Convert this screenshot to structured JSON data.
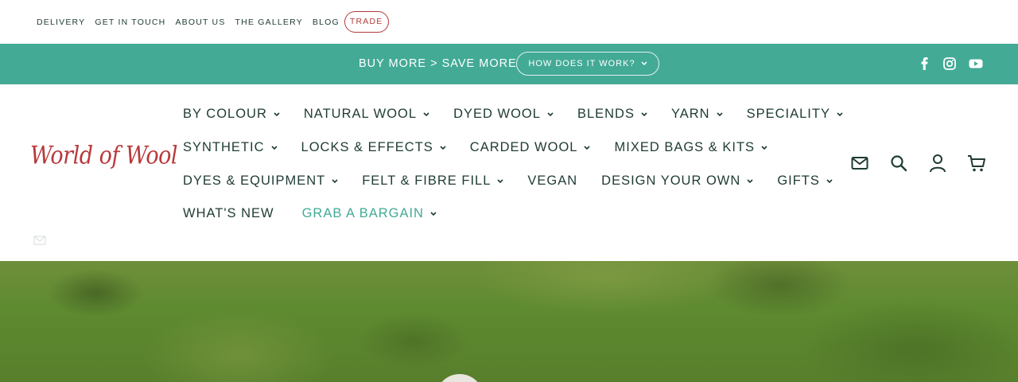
{
  "utility": {
    "links": [
      "DELIVERY",
      "GET IN TOUCH",
      "ABOUT US",
      "THE GALLERY",
      "BLOG"
    ],
    "trade": "TRADE"
  },
  "promo": {
    "text": "BUY MORE > SAVE MORE",
    "button": "HOW DOES IT WORK?",
    "social": [
      "facebook-icon",
      "instagram-icon",
      "youtube-icon"
    ]
  },
  "logo": {
    "text": "World of Wool"
  },
  "nav": {
    "rows": [
      [
        "BY COLOUR",
        "NATURAL WOOL",
        "DYED WOOL",
        "BLENDS",
        "YARN",
        "SPECIALITY"
      ],
      [
        "SYNTHETIC",
        "LOCKS & EFFECTS",
        "CARDED WOOL",
        "MIXED BAGS & KITS"
      ],
      [
        "DYES & EQUIPMENT",
        "FELT & FIBRE FILL",
        "VEGAN",
        "DESIGN YOUR OWN",
        "GIFTS"
      ],
      [
        "WHAT'S NEW",
        "GRAB A BARGAIN"
      ]
    ]
  },
  "header_icons": [
    "mail-icon",
    "search-icon",
    "account-icon",
    "cart-icon"
  ],
  "colors": {
    "teal": "#43aa96",
    "brand_red": "#b8393c",
    "text_dark": "#1f3b34"
  }
}
